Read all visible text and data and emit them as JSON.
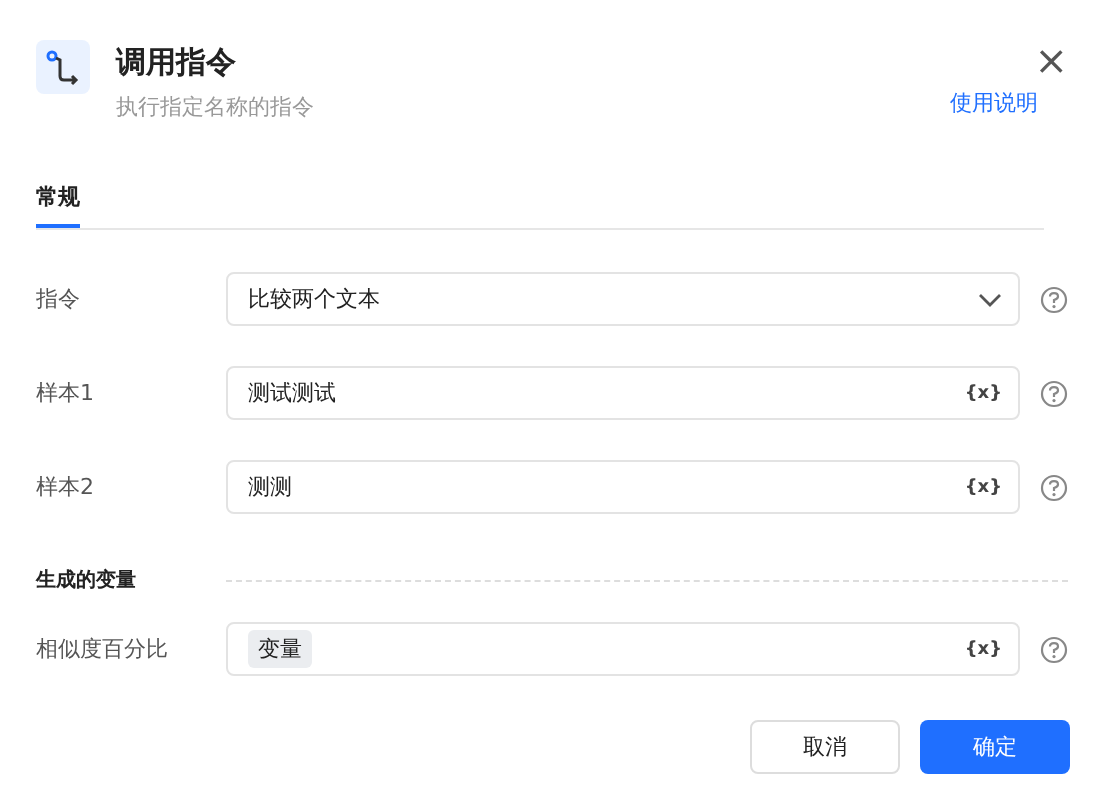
{
  "dialog": {
    "title": "调用指令",
    "subtitle": "执行指定名称的指令",
    "help_link": "使用说明",
    "close": "×"
  },
  "tabs": [
    {
      "label": "常规",
      "selected": true
    }
  ],
  "fields": [
    {
      "label": "指令",
      "kind": "select",
      "value": "比较两个文本"
    },
    {
      "label": "样本1",
      "kind": "text",
      "value": "测试测试",
      "var_button": "{x}"
    },
    {
      "label": "样本2",
      "kind": "text",
      "value": "测测",
      "var_button": "{x}"
    }
  ],
  "output_section": {
    "title": "生成的变量",
    "fields": [
      {
        "label": "相似度百分比",
        "kind": "tag",
        "value": "变量",
        "var_button": "{x}"
      }
    ]
  },
  "buttons": [
    {
      "label": "取消",
      "kind": "secondary"
    },
    {
      "label": "确定",
      "kind": "primary"
    }
  ]
}
